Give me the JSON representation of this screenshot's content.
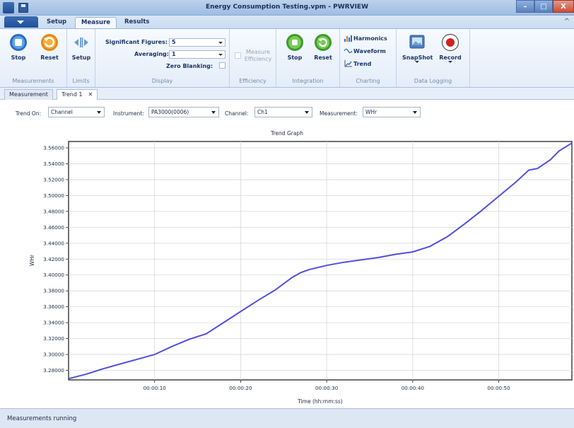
{
  "window": {
    "title": "Energy Consumption Testing.vpm - PWRVIEW",
    "controls": [
      "–",
      "□",
      "X"
    ]
  },
  "ribbon_tabs": [
    "Setup",
    "Measure",
    "Results"
  ],
  "active_ribbon_tab": "Measure",
  "ribbon": {
    "measurements": {
      "label": "Measurements",
      "stop": "Stop",
      "reset": "Reset"
    },
    "limits": {
      "label": "Limits",
      "setup": "Setup"
    },
    "display": {
      "label": "Display",
      "sig_figs_label": "Significant Figures:",
      "sig_figs_value": "5",
      "averaging_label": "Averaging:",
      "averaging_value": "1",
      "zero_blanking_label": "Zero Blanking:"
    },
    "efficiency": {
      "label": "Efficiency",
      "button": "Measure Efficiency"
    },
    "integration": {
      "label": "Integration",
      "stop": "Stop",
      "reset": "Reset"
    },
    "charting": {
      "label": "Charting",
      "harmonics": "Harmonics",
      "waveform": "Waveform",
      "trend": "Trend"
    },
    "data_logging": {
      "label": "Data Logging",
      "snapshot": "SnapShot",
      "record": "Record"
    }
  },
  "doc_tabs": {
    "measurement": "Measurement",
    "trend": "Trend 1",
    "close": "✕"
  },
  "trend_controls": {
    "trend_on_label": "Trend On:",
    "trend_on_value": "Channel",
    "instrument_label": "Instrument:",
    "instrument_value": "PA3000(0006)",
    "channel_label": "Channel:",
    "channel_value": "Ch1",
    "measurement_label": "Measurement:",
    "measurement_value": "WHr"
  },
  "chart_data": {
    "type": "line",
    "title": "Trend Graph",
    "xlabel": "Time (hh:mm:ss)",
    "ylabel": "WHr",
    "xlim": [
      0,
      58.5
    ],
    "ylim": [
      3.268,
      3.568
    ],
    "x_ticks": [
      10,
      20,
      30,
      40,
      50
    ],
    "x_tick_labels": [
      "00:00:10",
      "00:00:20",
      "00:00:30",
      "00:00:40",
      "00:00:50"
    ],
    "y_ticks": [
      3.28,
      3.3,
      3.32,
      3.34,
      3.36,
      3.38,
      3.4,
      3.42,
      3.44,
      3.46,
      3.48,
      3.5,
      3.52,
      3.54,
      3.56
    ],
    "y_tick_labels": [
      "3.28000",
      "3.30000",
      "3.32000",
      "3.34000",
      "3.36000",
      "3.38000",
      "3.40000",
      "3.42000",
      "3.44000",
      "3.46000",
      "3.48000",
      "3.50000",
      "3.52000",
      "3.54000",
      "3.56000"
    ],
    "grid": true,
    "line_color": "#4f4fe0",
    "series": [
      {
        "x": [
          0,
          2,
          4,
          6,
          8,
          10,
          12,
          14,
          16,
          17,
          18,
          20,
          22,
          24,
          26,
          27,
          28,
          30,
          32,
          34,
          36,
          38,
          40,
          42,
          44,
          46,
          48,
          50,
          52,
          53.5,
          54.5,
          56,
          57,
          58.5
        ],
        "values": [
          3.2695,
          3.275,
          3.282,
          3.288,
          3.294,
          3.3,
          3.31,
          3.319,
          3.326,
          3.333,
          3.34,
          3.354,
          3.368,
          3.381,
          3.397,
          3.403,
          3.407,
          3.412,
          3.416,
          3.419,
          3.422,
          3.426,
          3.429,
          3.436,
          3.448,
          3.464,
          3.481,
          3.499,
          3.517,
          3.532,
          3.534,
          3.545,
          3.556,
          3.566
        ]
      }
    ]
  },
  "status": {
    "text": "Measurements running"
  }
}
